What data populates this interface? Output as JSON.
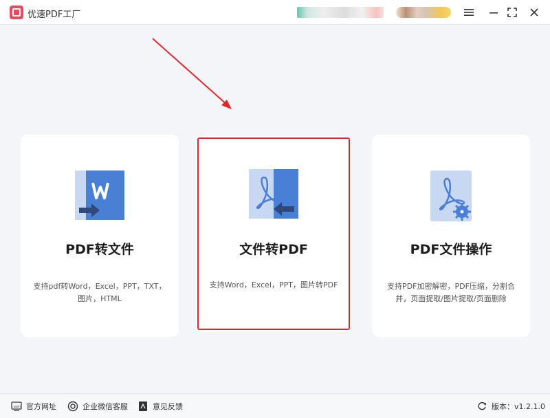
{
  "app": {
    "title": "优速PDF工厂"
  },
  "window_controls": {
    "menu_icon": "hamburger-icon",
    "minimize_icon": "minimize-icon",
    "maximize_icon": "maximize-icon",
    "close_icon": "close-icon"
  },
  "cards": [
    {
      "title": "PDF转文件",
      "description": "支持pdf转Word，Excel，PPT，TXT，图片，HTML",
      "icon": "pdf-to-word-icon"
    },
    {
      "title": "文件转PDF",
      "description": "支持Word，Excel，PPT，图片转PDF",
      "icon": "file-to-pdf-icon"
    },
    {
      "title": "PDF文件操作",
      "description": "支持PDF加密解密，PDF压缩，分割合并，页面提取/图片提取/页面删除",
      "icon": "pdf-settings-icon"
    }
  ],
  "footer": {
    "website": "官方网址",
    "wechat_support": "企业微信客服",
    "feedback": "意见反馈",
    "version": "版本：v1.2.1.0"
  },
  "colors": {
    "accent_blue": "#4a7fd6",
    "light_blue": "#c9d8f2",
    "highlight_red": "#e3262b",
    "logo_red": "#e84a5f"
  }
}
